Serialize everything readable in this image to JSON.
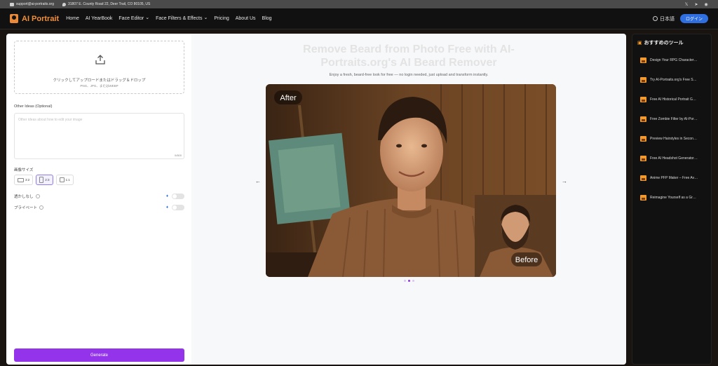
{
  "topbar": {
    "email": "support@ai-portraits.org",
    "address": "31807 E. County Road 22, Deer Trail, CO 80105, US"
  },
  "nav": {
    "logo": "AI Portrait",
    "items": [
      {
        "label": "Home",
        "dropdown": false
      },
      {
        "label": "AI YearBook",
        "dropdown": false
      },
      {
        "label": "Face Editor",
        "dropdown": true
      },
      {
        "label": "Face Filters & Effects",
        "dropdown": true
      },
      {
        "label": "Pricing",
        "dropdown": false
      },
      {
        "label": "About Us",
        "dropdown": false
      },
      {
        "label": "Blog",
        "dropdown": false
      }
    ],
    "language": "日本語",
    "login": "ログイン"
  },
  "upload": {
    "main_text": "クリックしてアップロードまたはドラッグ＆ドロップ",
    "sub_text": "PNG、JPG、またはWEBP"
  },
  "form": {
    "ideas_label": "Other Ideas (Optional)",
    "ideas_placeholder": "Other ideas about how to edit your image",
    "counter": "0/800",
    "size_label": "画像サイズ",
    "sizes": [
      {
        "label": "3:2",
        "selected": false
      },
      {
        "label": "2:3",
        "selected": true
      },
      {
        "label": "1:1",
        "selected": false
      }
    ],
    "toggles": [
      {
        "label": "透かしなし",
        "on": false
      },
      {
        "label": "プライベート",
        "on": false
      }
    ],
    "generate": "Generate"
  },
  "main": {
    "title": "Remove Beard from Photo Free with AI-Portraits.org's AI Beard Remover",
    "subtitle": "Enjoy a fresh, beard-free look for free — no login needed, just upload and transform instantly.",
    "after_label": "After",
    "before_label": "Before",
    "prev": "←",
    "next": "→",
    "slide_count": 3,
    "active_slide": 1
  },
  "sidebar": {
    "title": "おすすめのツール",
    "items": [
      "Design Your RPG Character…",
      "Try AI-Portraits.org's Free S…",
      "Free AI Historical Portrait G…",
      "Free Zombie Filter by AI-Por…",
      "Preview Hairstyles in Secon…",
      "Free AI Headshot Generator…",
      "Anime PFP Maker – Free Av…",
      "Reimagine Yourself as a Gr…"
    ]
  },
  "colors": {
    "brand": "#f08f3c",
    "primary_button": "#9333ea",
    "login_button": "#2f6fe0"
  }
}
